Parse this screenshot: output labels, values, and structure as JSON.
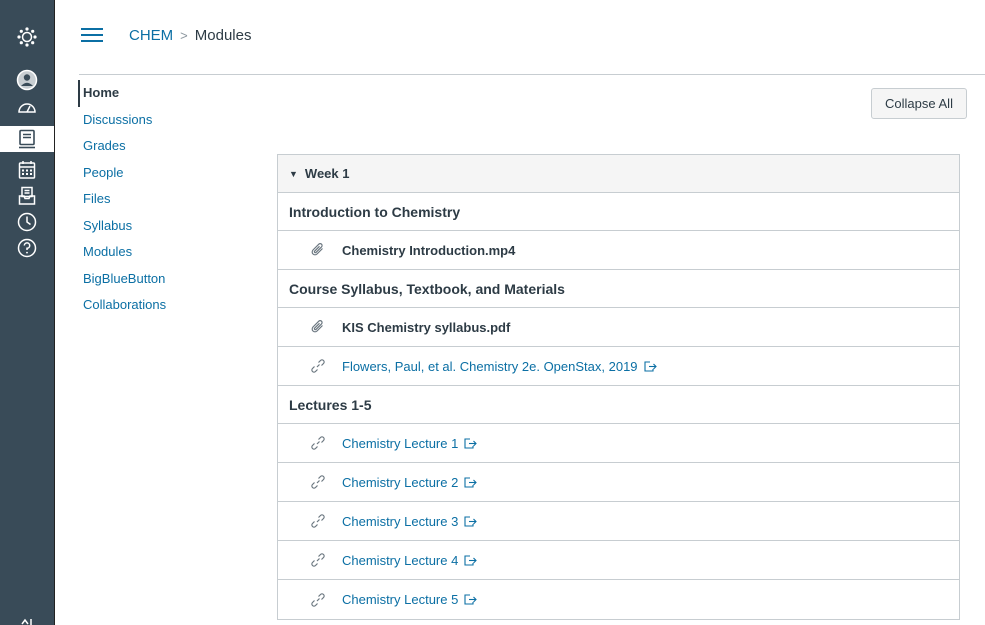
{
  "global_nav": {
    "icons": [
      "canvas-logo-icon",
      "account-icon",
      "dashboard-icon",
      "courses-icon",
      "calendar-icon",
      "inbox-icon",
      "history-icon",
      "help-icon"
    ],
    "active": "courses-icon"
  },
  "header": {
    "course": "CHEM",
    "separator": ">",
    "page": "Modules"
  },
  "course_nav": {
    "items": [
      {
        "label": "Home",
        "active": true
      },
      {
        "label": "Discussions"
      },
      {
        "label": "Grades"
      },
      {
        "label": "People"
      },
      {
        "label": "Files"
      },
      {
        "label": "Syllabus"
      },
      {
        "label": "Modules"
      },
      {
        "label": "BigBlueButton"
      },
      {
        "label": "Collaborations"
      }
    ]
  },
  "toolbar": {
    "collapse_all": "Collapse All"
  },
  "module": {
    "title": "Week 1",
    "sections": [
      {
        "title": "Introduction to Chemistry",
        "items": [
          {
            "type": "file",
            "icon": "attachment-icon",
            "title": "Chemistry Introduction.mp4"
          }
        ]
      },
      {
        "title": "Course Syllabus, Textbook, and Materials",
        "items": [
          {
            "type": "file",
            "icon": "attachment-icon",
            "title": "KIS Chemistry syllabus.pdf"
          },
          {
            "type": "link",
            "icon": "link-icon",
            "title": "Flowers, Paul, et al. Chemistry 2e. OpenStax, 2019"
          }
        ]
      },
      {
        "title": "Lectures 1-5",
        "items": [
          {
            "type": "link",
            "icon": "link-icon",
            "title": "Chemistry Lecture 1"
          },
          {
            "type": "link",
            "icon": "link-icon",
            "title": "Chemistry Lecture 2"
          },
          {
            "type": "link",
            "icon": "link-icon",
            "title": "Chemistry Lecture 3"
          },
          {
            "type": "link",
            "icon": "link-icon",
            "title": "Chemistry Lecture 4"
          },
          {
            "type": "link",
            "icon": "link-icon",
            "title": "Chemistry Lecture 5"
          }
        ]
      }
    ]
  },
  "colors": {
    "nav_background": "#394b58",
    "link": "#0b6fa4",
    "text": "#2d3b45",
    "border": "#c7cdd1"
  }
}
